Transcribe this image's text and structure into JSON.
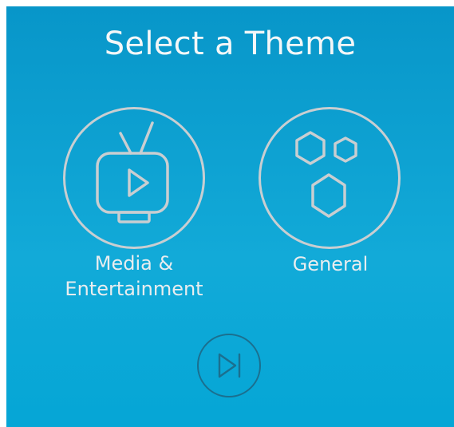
{
  "header": {
    "title": "Select a Theme"
  },
  "themes": [
    {
      "label": "Media &\nEntertainment",
      "icon": "tv-play-icon"
    },
    {
      "label": "General",
      "icon": "hexagons-icon"
    }
  ],
  "skip": {
    "icon": "skip-next-icon"
  },
  "colors": {
    "background_top": "#0896c9",
    "background_bottom": "#05a6d6",
    "icon_stroke": "#c9ced1",
    "skip_stroke": "#1b6f8f"
  }
}
